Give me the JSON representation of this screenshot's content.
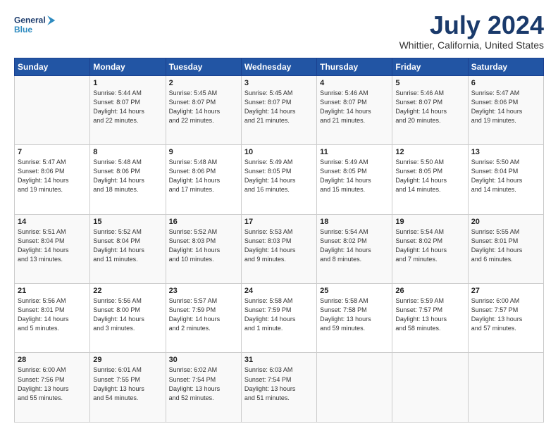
{
  "logo": {
    "line1": "General",
    "line2": "Blue"
  },
  "title": "July 2024",
  "subtitle": "Whittier, California, United States",
  "header_days": [
    "Sunday",
    "Monday",
    "Tuesday",
    "Wednesday",
    "Thursday",
    "Friday",
    "Saturday"
  ],
  "weeks": [
    [
      {
        "day": "",
        "info": ""
      },
      {
        "day": "1",
        "info": "Sunrise: 5:44 AM\nSunset: 8:07 PM\nDaylight: 14 hours\nand 22 minutes."
      },
      {
        "day": "2",
        "info": "Sunrise: 5:45 AM\nSunset: 8:07 PM\nDaylight: 14 hours\nand 22 minutes."
      },
      {
        "day": "3",
        "info": "Sunrise: 5:45 AM\nSunset: 8:07 PM\nDaylight: 14 hours\nand 21 minutes."
      },
      {
        "day": "4",
        "info": "Sunrise: 5:46 AM\nSunset: 8:07 PM\nDaylight: 14 hours\nand 21 minutes."
      },
      {
        "day": "5",
        "info": "Sunrise: 5:46 AM\nSunset: 8:07 PM\nDaylight: 14 hours\nand 20 minutes."
      },
      {
        "day": "6",
        "info": "Sunrise: 5:47 AM\nSunset: 8:06 PM\nDaylight: 14 hours\nand 19 minutes."
      }
    ],
    [
      {
        "day": "7",
        "info": "Sunrise: 5:47 AM\nSunset: 8:06 PM\nDaylight: 14 hours\nand 19 minutes."
      },
      {
        "day": "8",
        "info": "Sunrise: 5:48 AM\nSunset: 8:06 PM\nDaylight: 14 hours\nand 18 minutes."
      },
      {
        "day": "9",
        "info": "Sunrise: 5:48 AM\nSunset: 8:06 PM\nDaylight: 14 hours\nand 17 minutes."
      },
      {
        "day": "10",
        "info": "Sunrise: 5:49 AM\nSunset: 8:05 PM\nDaylight: 14 hours\nand 16 minutes."
      },
      {
        "day": "11",
        "info": "Sunrise: 5:49 AM\nSunset: 8:05 PM\nDaylight: 14 hours\nand 15 minutes."
      },
      {
        "day": "12",
        "info": "Sunrise: 5:50 AM\nSunset: 8:05 PM\nDaylight: 14 hours\nand 14 minutes."
      },
      {
        "day": "13",
        "info": "Sunrise: 5:50 AM\nSunset: 8:04 PM\nDaylight: 14 hours\nand 14 minutes."
      }
    ],
    [
      {
        "day": "14",
        "info": "Sunrise: 5:51 AM\nSunset: 8:04 PM\nDaylight: 14 hours\nand 13 minutes."
      },
      {
        "day": "15",
        "info": "Sunrise: 5:52 AM\nSunset: 8:04 PM\nDaylight: 14 hours\nand 11 minutes."
      },
      {
        "day": "16",
        "info": "Sunrise: 5:52 AM\nSunset: 8:03 PM\nDaylight: 14 hours\nand 10 minutes."
      },
      {
        "day": "17",
        "info": "Sunrise: 5:53 AM\nSunset: 8:03 PM\nDaylight: 14 hours\nand 9 minutes."
      },
      {
        "day": "18",
        "info": "Sunrise: 5:54 AM\nSunset: 8:02 PM\nDaylight: 14 hours\nand 8 minutes."
      },
      {
        "day": "19",
        "info": "Sunrise: 5:54 AM\nSunset: 8:02 PM\nDaylight: 14 hours\nand 7 minutes."
      },
      {
        "day": "20",
        "info": "Sunrise: 5:55 AM\nSunset: 8:01 PM\nDaylight: 14 hours\nand 6 minutes."
      }
    ],
    [
      {
        "day": "21",
        "info": "Sunrise: 5:56 AM\nSunset: 8:01 PM\nDaylight: 14 hours\nand 5 minutes."
      },
      {
        "day": "22",
        "info": "Sunrise: 5:56 AM\nSunset: 8:00 PM\nDaylight: 14 hours\nand 3 minutes."
      },
      {
        "day": "23",
        "info": "Sunrise: 5:57 AM\nSunset: 7:59 PM\nDaylight: 14 hours\nand 2 minutes."
      },
      {
        "day": "24",
        "info": "Sunrise: 5:58 AM\nSunset: 7:59 PM\nDaylight: 14 hours\nand 1 minute."
      },
      {
        "day": "25",
        "info": "Sunrise: 5:58 AM\nSunset: 7:58 PM\nDaylight: 13 hours\nand 59 minutes."
      },
      {
        "day": "26",
        "info": "Sunrise: 5:59 AM\nSunset: 7:57 PM\nDaylight: 13 hours\nand 58 minutes."
      },
      {
        "day": "27",
        "info": "Sunrise: 6:00 AM\nSunset: 7:57 PM\nDaylight: 13 hours\nand 57 minutes."
      }
    ],
    [
      {
        "day": "28",
        "info": "Sunrise: 6:00 AM\nSunset: 7:56 PM\nDaylight: 13 hours\nand 55 minutes."
      },
      {
        "day": "29",
        "info": "Sunrise: 6:01 AM\nSunset: 7:55 PM\nDaylight: 13 hours\nand 54 minutes."
      },
      {
        "day": "30",
        "info": "Sunrise: 6:02 AM\nSunset: 7:54 PM\nDaylight: 13 hours\nand 52 minutes."
      },
      {
        "day": "31",
        "info": "Sunrise: 6:03 AM\nSunset: 7:54 PM\nDaylight: 13 hours\nand 51 minutes."
      },
      {
        "day": "",
        "info": ""
      },
      {
        "day": "",
        "info": ""
      },
      {
        "day": "",
        "info": ""
      }
    ]
  ]
}
